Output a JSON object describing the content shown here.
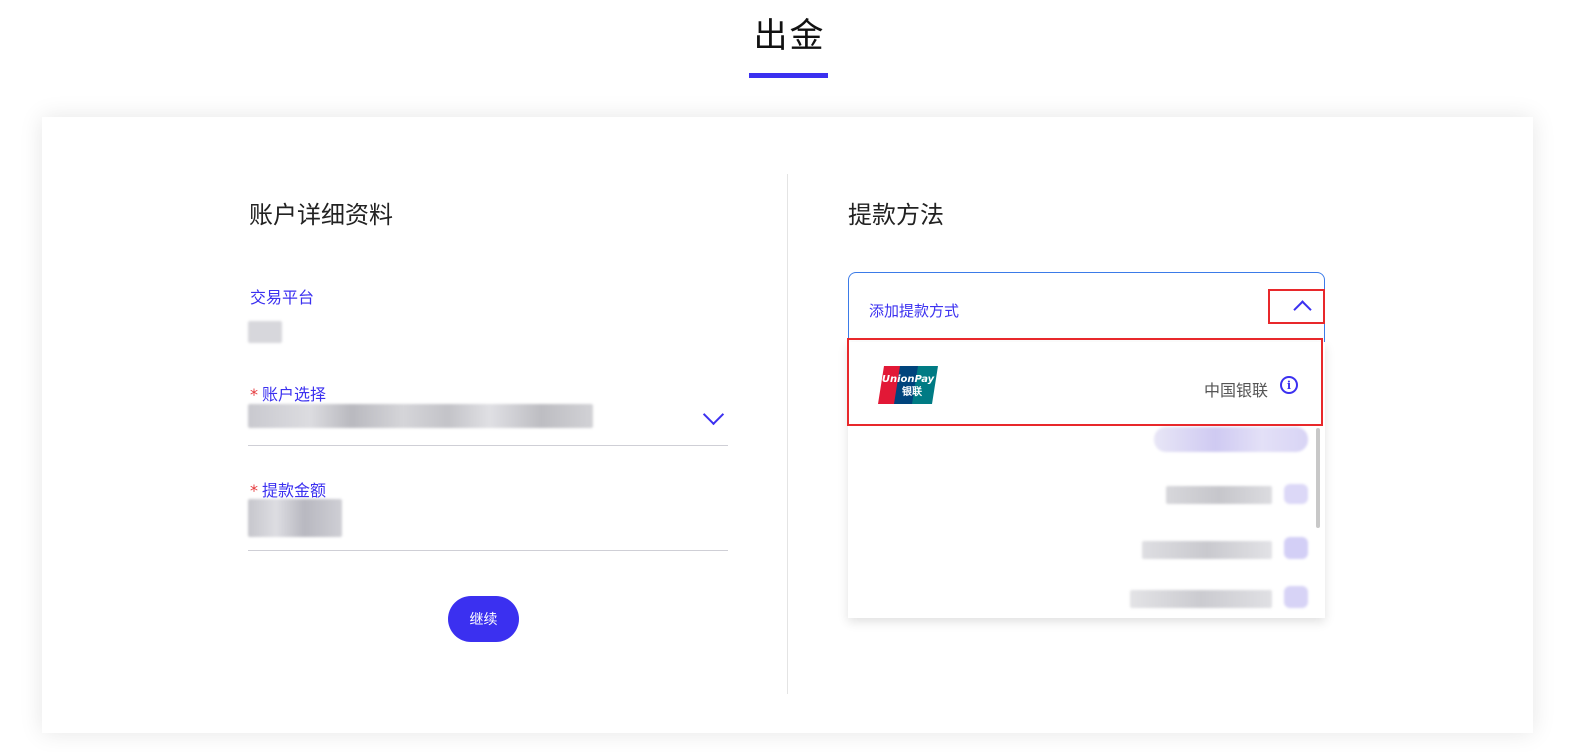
{
  "header": {
    "title": "出金"
  },
  "account_details": {
    "title": "账户详细资料",
    "platform_label": "交易平台",
    "account_select_label": "账户选择",
    "amount_label": "提款金额",
    "required_mark": "*",
    "continue_label": "继续"
  },
  "withdrawal": {
    "title": "提款方法",
    "select_placeholder": "添加提款方式",
    "options": [
      {
        "logo_text": "UnionPay",
        "logo_sub": "银联",
        "name": "中国银联",
        "icon": "info-icon"
      }
    ]
  },
  "colors": {
    "accent": "#3b30f0",
    "highlight": "#e8282b",
    "select_border": "#3b7be8"
  }
}
